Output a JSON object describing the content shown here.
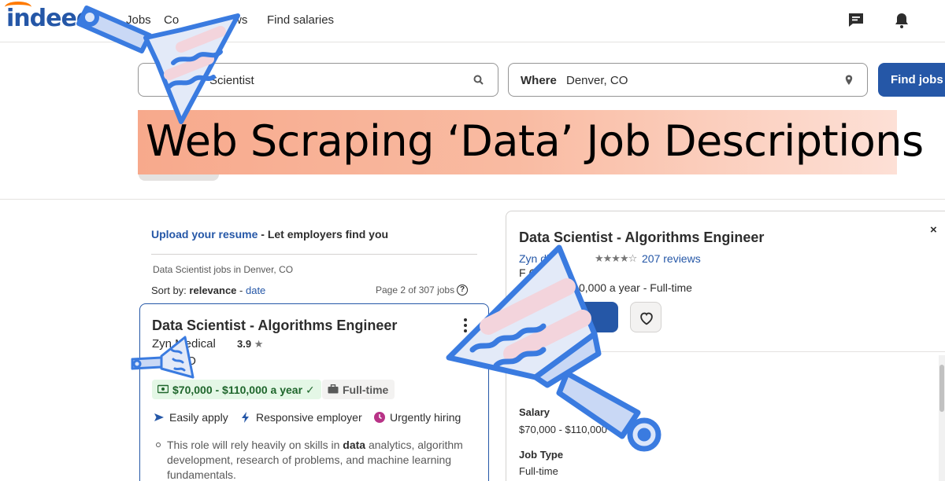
{
  "header": {
    "logo_text": "indeed",
    "nav": [
      "Jobs",
      "Co",
      "ws",
      "Find salaries"
    ],
    "icons": [
      "message-icon",
      "notifications-bell-icon"
    ]
  },
  "search": {
    "what_value": "Scientist",
    "where_label": "Where",
    "where_value": "Denver, CO",
    "find_button": "Find jobs"
  },
  "banner": {
    "text": "Web Scraping ‘Data’ Job Descriptions"
  },
  "left": {
    "upload_link": "Upload your resume",
    "upload_rest": " - Let employers find you",
    "jobs_in": "Data Scientist jobs in Denver, CO",
    "sort_label": "Sort by: ",
    "sort_selected": "relevance",
    "sort_sep": " - ",
    "sort_other": "date",
    "page_info": "Page 2 of 307 jobs",
    "card": {
      "title": "Data Scientist - Algorithms Engineer",
      "company": "Zyn Medical",
      "rating": "3.9",
      "rating_star": "★",
      "location": "ood, CO",
      "salary": "$70,000 - $110,000 a year",
      "salary_check": "✓",
      "job_type": "Full-time",
      "attributes": [
        "Easily apply",
        "Responsive employer",
        "Urgently hiring"
      ],
      "snippet_pre": "This role will rely heavily on skills in ",
      "snippet_bold": "data",
      "snippet_post": " analytics, algorithm development, research of problems, and machine learning fundamentals."
    }
  },
  "right": {
    "close": "×",
    "title": "Data Scientist - Algorithms Engineer",
    "company": "Zyn dical",
    "stars": "★★★★☆",
    "reviews": "207 reviews",
    "location": "F CO",
    "salary_type": "0,000 a year - Full-time",
    "salary_heading": "Salary",
    "salary_value": "$70,000 - $110,000",
    "job_type_heading": "Job Type",
    "job_type_value": "Full-time"
  },
  "colors": {
    "brand_blue": "#2557a7",
    "banner_gradient_start": "#f7a98c",
    "banner_gradient_end": "#fde0d6",
    "salary_tag_bg": "#e4f7e6",
    "scraper_stroke": "#3a7be0"
  }
}
